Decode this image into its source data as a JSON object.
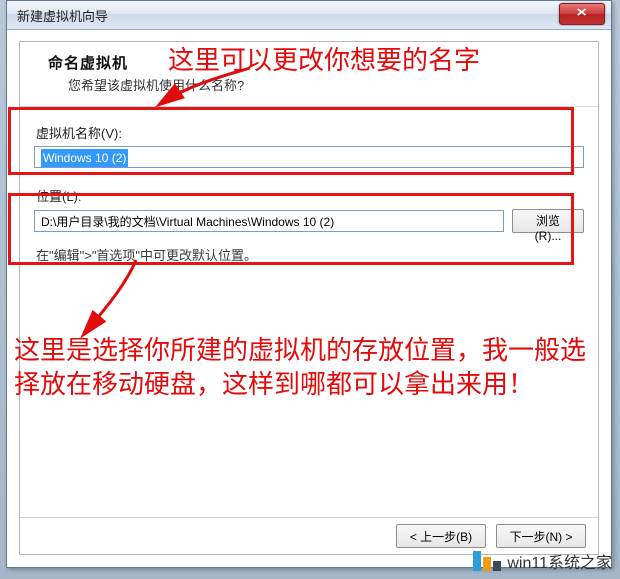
{
  "window": {
    "title": "新建虚拟机向导",
    "close_glyph": "✕"
  },
  "header": {
    "title": "命名虚拟机",
    "subtitle": "您希望该虚拟机使用什么名称?"
  },
  "fields": {
    "name_label": "虚拟机名称(V):",
    "name_value": "Windows 10 (2)",
    "location_label": "位置(L):",
    "location_value": "D:\\用户目录\\我的文档\\Virtual Machines\\Windows 10 (2)",
    "browse_label": "浏览(R)..."
  },
  "hint": "在\"编辑\">\"首选项\"中可更改默认位置。",
  "buttons": {
    "back": "< 上一步(B)",
    "next": "下一步(N) >"
  },
  "annotations": {
    "top": "这里可以更改你想要的名字",
    "bottom": "这里是选择你所建的虚拟机的存放位置，我一般选择放在移动硬盘，这样到哪都可以拿出来用！"
  },
  "brand": {
    "text": "win11系统之家"
  }
}
